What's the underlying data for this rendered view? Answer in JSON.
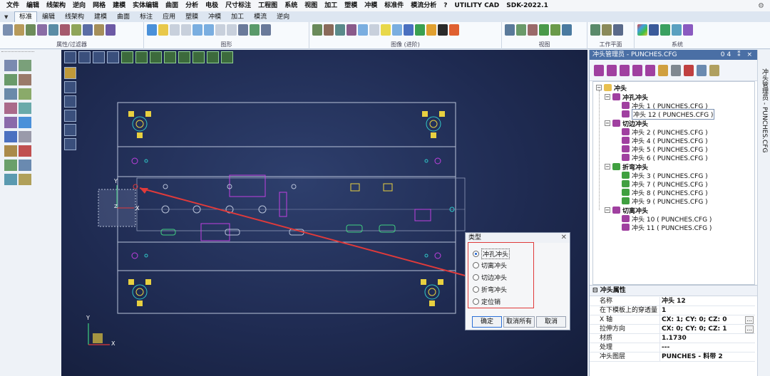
{
  "menubar": {
    "items": [
      "文件",
      "编辑",
      "线架构",
      "逆向",
      "网格",
      "建模",
      "实体编辑",
      "曲面",
      "分析",
      "电极",
      "尺寸标注",
      "工程图",
      "系统",
      "视图",
      "加工",
      "塑模",
      "冲模",
      "标准件",
      "模流分析",
      "?",
      "UTILITY CAD",
      "SDK-2022.1"
    ],
    "settings_icon": "gear-icon"
  },
  "ribbon": {
    "tabs": [
      "标准",
      "编辑",
      "线架构",
      "建模",
      "曲面",
      "标注",
      "应用",
      "塑膜",
      "冲模",
      "加工",
      "模流",
      "逆向"
    ],
    "active_tab": "标准",
    "groups": [
      "属性/过滤器",
      "图形",
      "图像 (进阶)",
      "视图",
      "工作平面",
      "系统"
    ]
  },
  "dialog": {
    "title": "类型",
    "options": [
      "冲孔冲头",
      "切离冲头",
      "切边冲头",
      "折弯冲头",
      "定位销"
    ],
    "selected": "冲孔冲头",
    "buttons": {
      "ok": "确定",
      "cancel_all": "取消所有",
      "cancel": "取消"
    }
  },
  "panel": {
    "title": "冲头管理员 - PUNCHES.CFG",
    "title_buttons": "04 ⁑ ×",
    "tree": {
      "root": "冲头",
      "groups": [
        {
          "name": "冲孔冲头",
          "items": [
            "冲头 1 ( PUNCHES.CFG )",
            "冲头 12 ( PUNCHES.CFG )"
          ]
        },
        {
          "name": "切边冲头",
          "items": [
            "冲头 2 ( PUNCHES.CFG )",
            "冲头 4 ( PUNCHES.CFG )",
            "冲头 5 ( PUNCHES.CFG )",
            "冲头 6 ( PUNCHES.CFG )"
          ]
        },
        {
          "name": "折弯冲头",
          "items": [
            "冲头 3 ( PUNCHES.CFG )",
            "冲头 7 ( PUNCHES.CFG )",
            "冲头 8 ( PUNCHES.CFG )",
            "冲头 9 ( PUNCHES.CFG )"
          ]
        },
        {
          "name": "切离冲头",
          "items": [
            "冲头 10 ( PUNCHES.CFG )",
            "冲头 11 ( PUNCHES.CFG )"
          ]
        }
      ],
      "selected_item": "冲头 12 ( PUNCHES.CFG )"
    },
    "props_title": "冲头属性",
    "props": [
      {
        "k": "名称",
        "v": "冲头 12"
      },
      {
        "k": "在下模板上的穿透量",
        "v": "1"
      },
      {
        "k": "X 轴",
        "v": "CX: 1; CY: 0; CZ: 0"
      },
      {
        "k": "拉伸方向",
        "v": "CX: 0; CY: 0; CZ: 1"
      },
      {
        "k": "材质",
        "v": "1.1730"
      },
      {
        "k": "处理",
        "v": "---"
      },
      {
        "k": "冲头图层",
        "v": "PUNCHES - 料带 2"
      }
    ],
    "side_tab": "冲头管理员 - PUNCHES.CFG"
  },
  "viewport": {
    "axis_x": "X",
    "axis_y": "Y",
    "axis_z": "Z"
  },
  "colors": {
    "viewport_bg": "#1f2b52",
    "highlight": "#e03a3a",
    "magenta": "#c040e0",
    "yellow": "#e8d040",
    "cyan": "#30c8c8"
  }
}
